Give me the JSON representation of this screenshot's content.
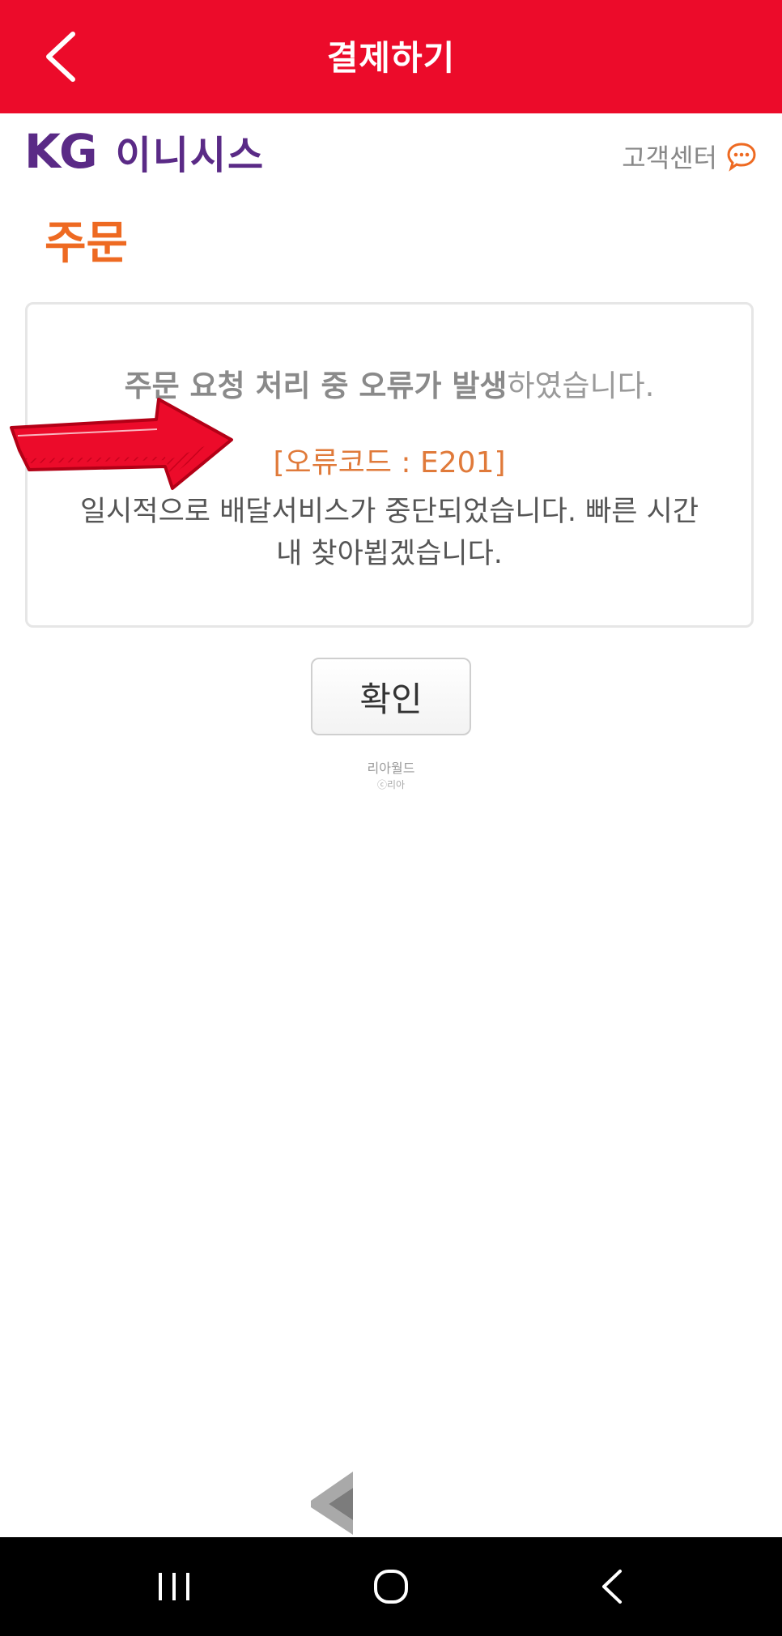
{
  "topbar": {
    "title": "결제하기",
    "back_icon": "chevron-left-icon"
  },
  "brand": {
    "kg": "KG",
    "name": "이니시스"
  },
  "support": {
    "label": "고객센터",
    "icon": "chat-bubble-icon"
  },
  "section": {
    "title": "주문"
  },
  "error_panel": {
    "heading_bold": "주문 요청 처리 중 오류가 발생",
    "heading_rest": "하였습니다.",
    "error_code": "[오류코드 : E201]",
    "body_line1": "일시적으로 배달서비스가 중단되었습니다. 빠른 시간",
    "body_line2": "내 찾아뵙겠습니다."
  },
  "annotation": {
    "icon": "red-arrow-icon"
  },
  "confirm": {
    "label": "확인"
  },
  "footer": {
    "name": "리아월드",
    "copyright": "ⓒ리아"
  },
  "system_nav": {
    "recents_icon": "recents-icon",
    "home_icon": "home-icon",
    "back_icon": "back-icon"
  },
  "colors": {
    "header": "#ec0b2a",
    "brand": "#5a2a86",
    "accent": "#ee6a22",
    "error_code": "#e07a3a"
  }
}
